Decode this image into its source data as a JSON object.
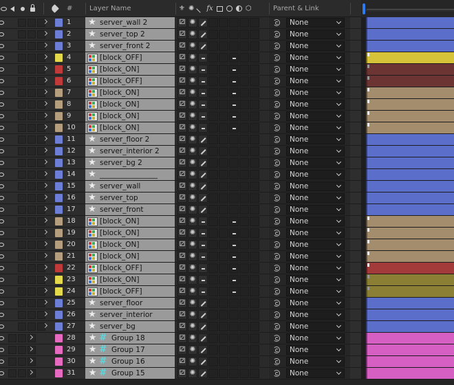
{
  "header": {
    "layer_name_label": "Layer Name",
    "parent_link_label": "Parent & Link",
    "number_label": "#"
  },
  "colors": {
    "blue": "#6d7ed6",
    "yellow": "#e4d94a",
    "red": "#c03a3a",
    "sandstone": "#b59e7d",
    "pink": "#e66ac0",
    "bar_blue": "#5b6ec9",
    "bar_yellow": "#d7c33a",
    "bar_red": "#a33b3b",
    "bar_sand": "#a48d6c",
    "bar_pink": "#d65fc4",
    "playhead": "#2c7bf0"
  },
  "layers": [
    {
      "num": "1",
      "name": "server_wall 2",
      "color": "blue",
      "type": "star",
      "parent": "None"
    },
    {
      "num": "2",
      "name": "server_top 2",
      "color": "blue",
      "type": "star",
      "parent": "None"
    },
    {
      "num": "3",
      "name": "server_front 2",
      "color": "blue",
      "type": "star",
      "parent": "None"
    },
    {
      "num": "4",
      "name": "[block_OFF]",
      "color": "yellow",
      "type": "precomp",
      "parent": "None"
    },
    {
      "num": "5",
      "name": "[block_ON]",
      "color": "red",
      "type": "precomp",
      "parent": "None",
      "bar_inactive": true
    },
    {
      "num": "6",
      "name": "[block_OFF]",
      "color": "red",
      "type": "precomp",
      "parent": "None",
      "bar_inactive": true
    },
    {
      "num": "7",
      "name": "[block_ON]",
      "color": "sandstone",
      "type": "precomp",
      "parent": "None"
    },
    {
      "num": "8",
      "name": "[block_ON]",
      "color": "sandstone",
      "type": "precomp",
      "parent": "None"
    },
    {
      "num": "9",
      "name": "[block_ON]",
      "color": "sandstone",
      "type": "precomp",
      "parent": "None"
    },
    {
      "num": "10",
      "name": "[block_ON]",
      "color": "sandstone",
      "type": "precomp",
      "parent": "None"
    },
    {
      "num": "11",
      "name": "server_floor 2",
      "color": "blue",
      "type": "star",
      "parent": "None"
    },
    {
      "num": "12",
      "name": "server_interior 2",
      "color": "blue",
      "type": "star",
      "parent": "None"
    },
    {
      "num": "13",
      "name": "server_bg 2",
      "color": "blue",
      "type": "star",
      "parent": "None"
    },
    {
      "num": "14",
      "name": "________________",
      "color": "blue",
      "type": "star",
      "parent": "None"
    },
    {
      "num": "15",
      "name": "server_wall",
      "color": "blue",
      "type": "star",
      "parent": "None"
    },
    {
      "num": "16",
      "name": "server_top",
      "color": "blue",
      "type": "star",
      "parent": "None"
    },
    {
      "num": "17",
      "name": "server_front",
      "color": "blue",
      "type": "star",
      "parent": "None"
    },
    {
      "num": "18",
      "name": "[block_ON]",
      "color": "sandstone",
      "type": "precomp",
      "parent": "None"
    },
    {
      "num": "19",
      "name": "[block_ON]",
      "color": "sandstone",
      "type": "precomp",
      "parent": "None"
    },
    {
      "num": "20",
      "name": "[block_ON]",
      "color": "sandstone",
      "type": "precomp",
      "parent": "None"
    },
    {
      "num": "21",
      "name": "[block_ON]",
      "color": "sandstone",
      "type": "precomp",
      "parent": "None"
    },
    {
      "num": "22",
      "name": "[block_OFF]",
      "color": "red",
      "type": "precomp",
      "parent": "None"
    },
    {
      "num": "23",
      "name": "[block_ON]",
      "color": "yellow",
      "type": "precomp",
      "parent": "None",
      "bar_inactive": true
    },
    {
      "num": "24",
      "name": "[block_OFF]",
      "color": "yellow",
      "type": "precomp",
      "parent": "None",
      "bar_inactive": true
    },
    {
      "num": "25",
      "name": "server_floor",
      "color": "blue",
      "type": "star",
      "parent": "None"
    },
    {
      "num": "26",
      "name": "server_interior",
      "color": "blue",
      "type": "star",
      "parent": "None"
    },
    {
      "num": "27",
      "name": "server_bg",
      "color": "blue",
      "type": "star",
      "parent": "None"
    },
    {
      "num": "28",
      "name": "Group 18",
      "color": "pink",
      "type": "shape",
      "parent": "None"
    },
    {
      "num": "29",
      "name": "Group 17",
      "color": "pink",
      "type": "shape",
      "parent": "None"
    },
    {
      "num": "30",
      "name": "Group 16",
      "color": "pink",
      "type": "shape",
      "parent": "None"
    },
    {
      "num": "31",
      "name": "Group 15",
      "color": "pink",
      "type": "shape",
      "parent": "None"
    }
  ]
}
